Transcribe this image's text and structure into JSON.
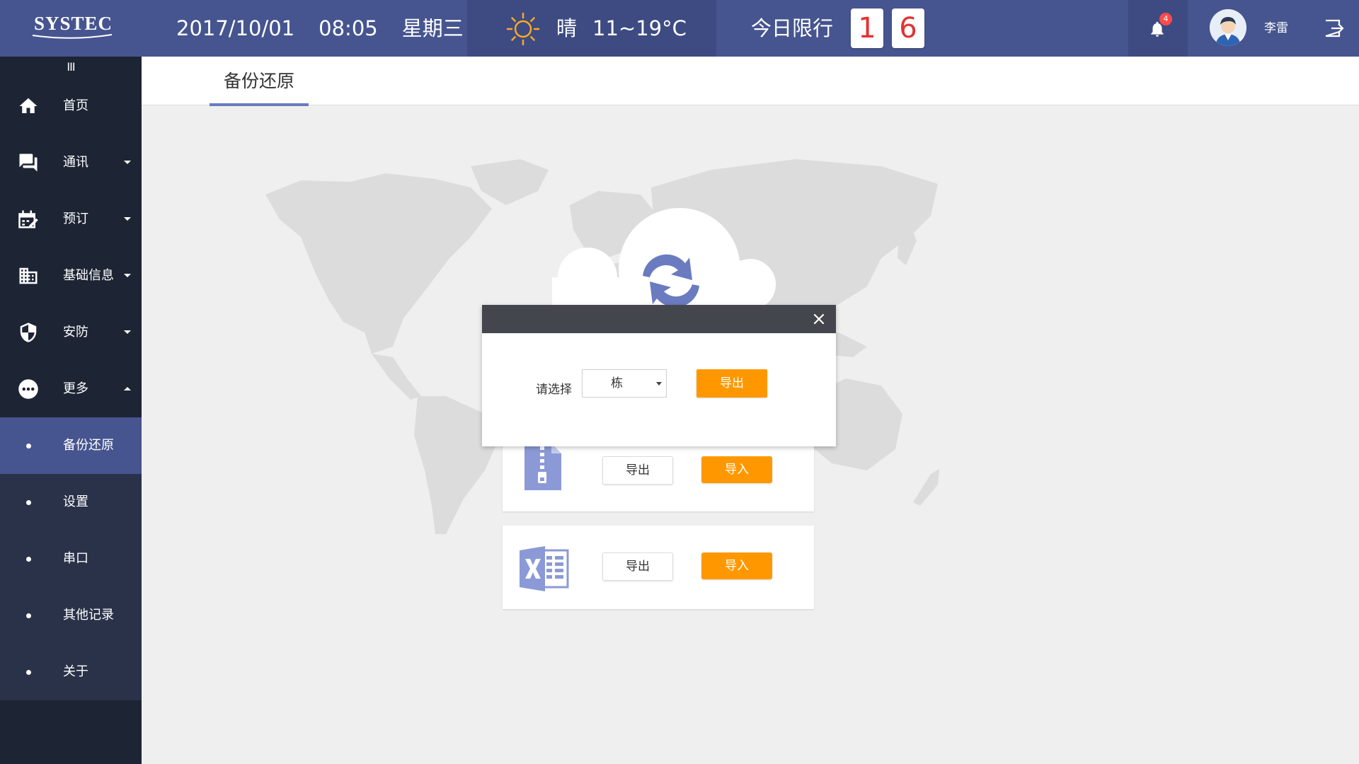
{
  "header": {
    "logo": "SYSTEC",
    "date": "2017/10/01",
    "time": "08:05",
    "weekday": "星期三",
    "weather": {
      "condition": "晴",
      "temperature": "11~19°C",
      "icon": "sun-icon"
    },
    "traffic_limit": {
      "label": "今日限行",
      "digits": [
        "1",
        "6"
      ]
    },
    "notifications": {
      "count": "4",
      "icon": "bell-icon"
    },
    "user": {
      "name": "李雷"
    },
    "logout_icon": "logout-icon"
  },
  "sidebar": {
    "toggle": "III",
    "items": [
      {
        "label": "首页",
        "icon": "home-icon"
      },
      {
        "label": "通讯",
        "icon": "chat-icon"
      },
      {
        "label": "预订",
        "icon": "booking-icon"
      },
      {
        "label": "基础信息",
        "icon": "building-icon"
      },
      {
        "label": "安防",
        "icon": "shield-icon"
      },
      {
        "label": "更多",
        "icon": "more-icon"
      }
    ],
    "submenu": [
      {
        "label": "备份还原",
        "active": true
      },
      {
        "label": "设置"
      },
      {
        "label": "串口"
      },
      {
        "label": "其他记录"
      },
      {
        "label": "关于"
      }
    ]
  },
  "main": {
    "tab": "备份还原",
    "cards": [
      {
        "icon": "zip-file-icon",
        "export_label": "导出",
        "import_label": "导入"
      },
      {
        "icon": "excel-file-icon",
        "export_label": "导出",
        "import_label": "导入"
      }
    ]
  },
  "dialog": {
    "label": "请选择",
    "select_value": "栋",
    "export_label": "导出"
  },
  "colors": {
    "header_bg": "#46558f",
    "sidebar_bg": "#1d2434",
    "submenu_bg": "#293249",
    "accent": "#ff9800",
    "plate_text": "#e33232"
  }
}
